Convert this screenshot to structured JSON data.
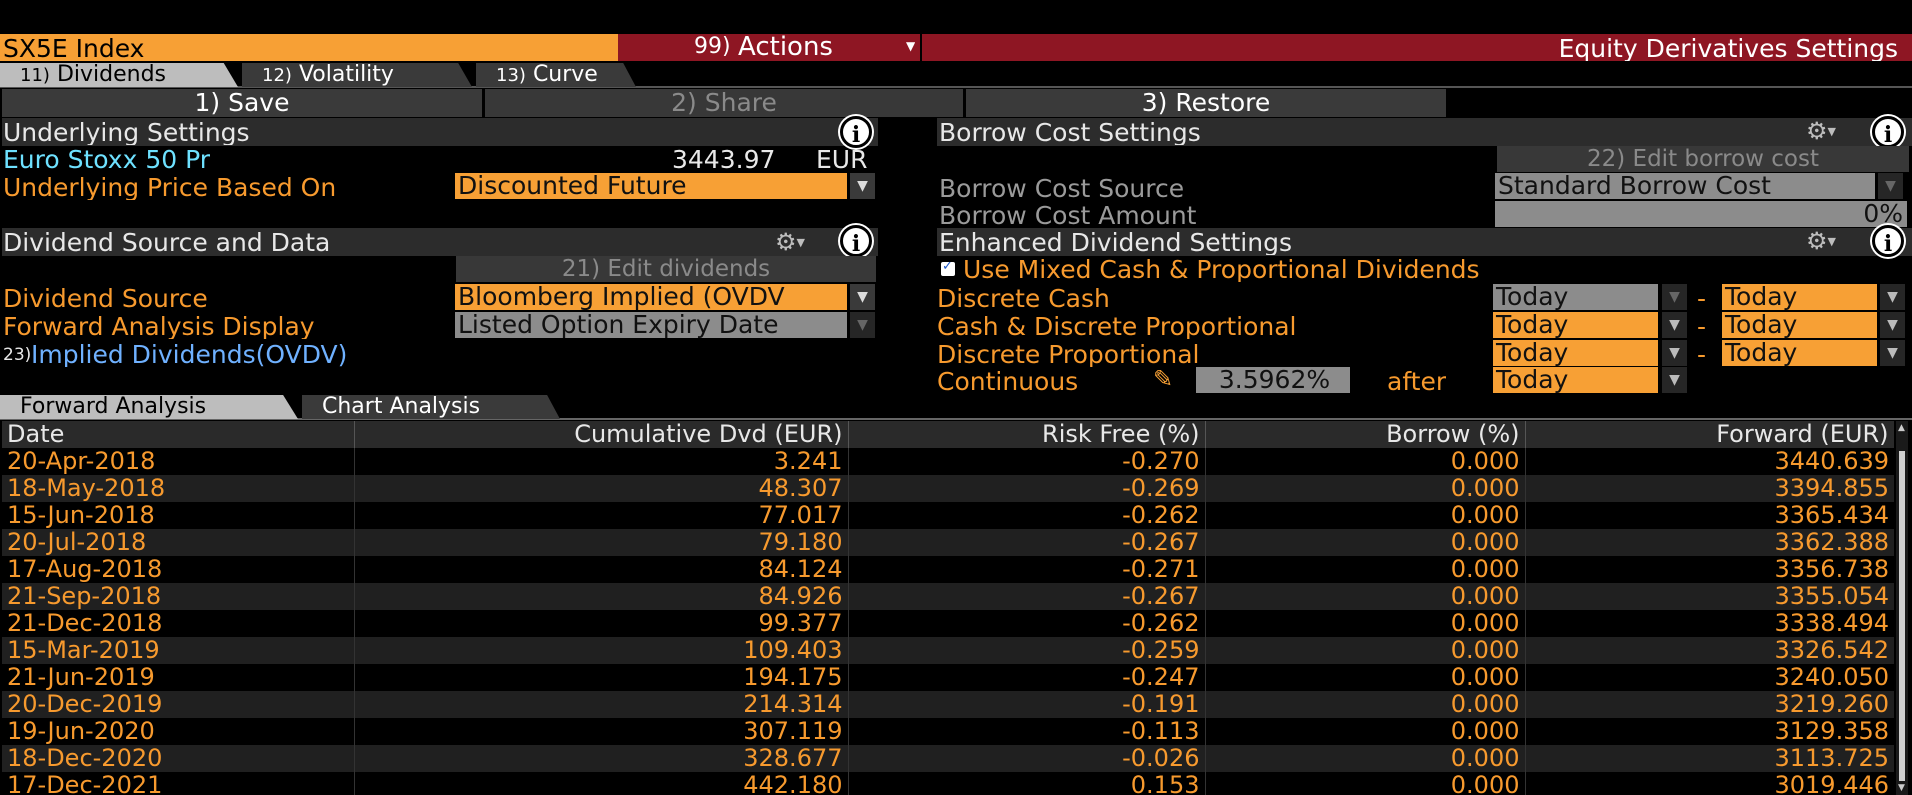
{
  "topbar": {
    "ticker": "SX5E Index",
    "actions_num": "99)",
    "actions_label": "Actions",
    "title": "Equity Derivatives Settings"
  },
  "tabs": [
    {
      "num": "11)",
      "label": "Dividends"
    },
    {
      "num": "12)",
      "label": "Volatility"
    },
    {
      "num": "13)",
      "label": "Curve"
    }
  ],
  "toolbar": {
    "save": "1) Save",
    "share": "2) Share",
    "restore": "3) Restore"
  },
  "underlying": {
    "header": "Underlying Settings",
    "name": "Euro Stoxx 50 Pr",
    "price": "3443.97",
    "currency": "EUR",
    "price_basis_label": "Underlying Price Based On",
    "price_basis_value": "Discounted Future"
  },
  "dividend_source": {
    "header": "Dividend Source and Data",
    "edit_button": "21) Edit dividends",
    "source_label": "Dividend Source",
    "source_value": "Bloomberg Implied (OVDV",
    "forward_display_label": "Forward Analysis Display",
    "forward_display_value": "Listed Option Expiry Date",
    "implied_link_num": "23)",
    "implied_link": "Implied Dividends(OVDV)"
  },
  "borrow": {
    "header": "Borrow Cost Settings",
    "edit_button": "22) Edit borrow cost",
    "source_label": "Borrow Cost Source",
    "source_value": "Standard Borrow Cost",
    "amount_label": "Borrow Cost Amount",
    "amount_value": "0%"
  },
  "enhanced": {
    "header": "Enhanced Dividend Settings",
    "checkbox_label": "Use Mixed Cash & Proportional Dividends",
    "rows": [
      {
        "label": "Discrete Cash",
        "from": "Today",
        "to": "Today"
      },
      {
        "label": "Cash & Discrete Proportional",
        "from": "Today",
        "to": "Today"
      },
      {
        "label": "Discrete Proportional",
        "from": "Today",
        "to": "Today"
      }
    ],
    "continuous_label": "Continuous",
    "continuous_value": "3.5962%",
    "after_label": "after",
    "after_value": "Today",
    "dash": "-"
  },
  "analysis_tabs": [
    "Forward Analysis",
    "Chart Analysis"
  ],
  "table": {
    "columns": [
      "Date",
      "Cumulative Dvd (EUR)",
      "Risk Free (%)",
      "Borrow (%)",
      "Forward (EUR)"
    ],
    "rows": [
      [
        "20-Apr-2018",
        "3.241",
        "-0.270",
        "0.000",
        "3440.639"
      ],
      [
        "18-May-2018",
        "48.307",
        "-0.269",
        "0.000",
        "3394.855"
      ],
      [
        "15-Jun-2018",
        "77.017",
        "-0.262",
        "0.000",
        "3365.434"
      ],
      [
        "20-Jul-2018",
        "79.180",
        "-0.267",
        "0.000",
        "3362.388"
      ],
      [
        "17-Aug-2018",
        "84.124",
        "-0.271",
        "0.000",
        "3356.738"
      ],
      [
        "21-Sep-2018",
        "84.926",
        "-0.267",
        "0.000",
        "3355.054"
      ],
      [
        "21-Dec-2018",
        "99.377",
        "-0.262",
        "0.000",
        "3338.494"
      ],
      [
        "15-Mar-2019",
        "109.403",
        "-0.259",
        "0.000",
        "3326.542"
      ],
      [
        "21-Jun-2019",
        "194.175",
        "-0.247",
        "0.000",
        "3240.050"
      ],
      [
        "20-Dec-2019",
        "214.314",
        "-0.191",
        "0.000",
        "3219.260"
      ],
      [
        "19-Jun-2020",
        "307.119",
        "-0.113",
        "0.000",
        "3129.358"
      ],
      [
        "18-Dec-2020",
        "328.677",
        "-0.026",
        "0.000",
        "3113.725"
      ],
      [
        "17-Dec-2021",
        "442.180",
        "0.153",
        "0.000",
        "3019.446"
      ]
    ]
  }
}
